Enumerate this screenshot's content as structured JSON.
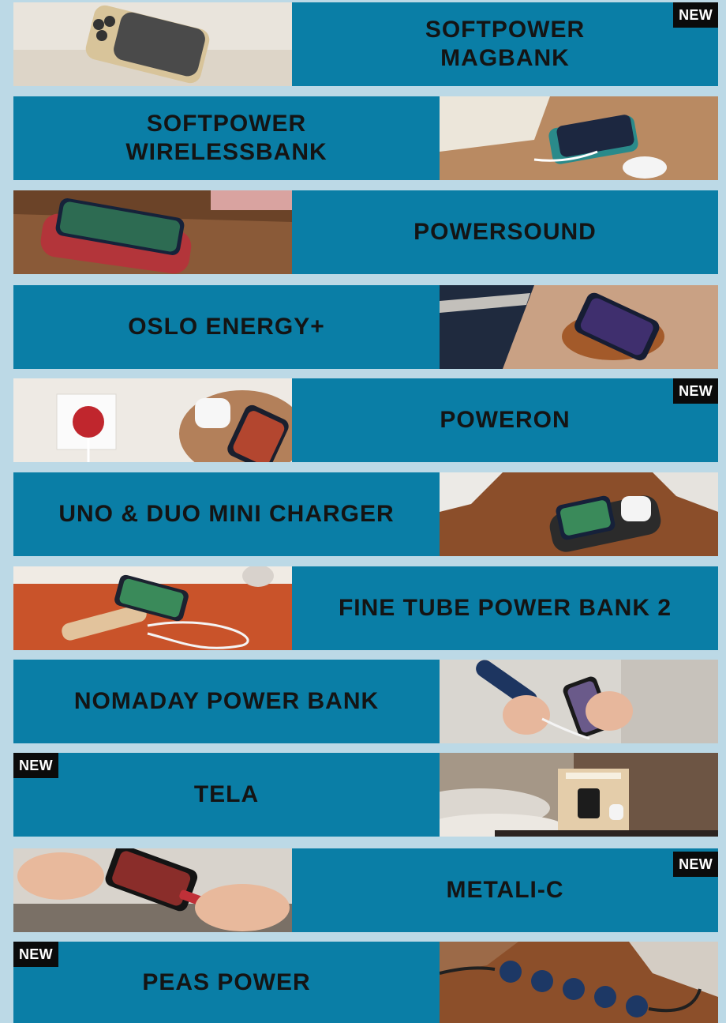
{
  "badge_text": "NEW",
  "colors": {
    "background": "#bcd9e6",
    "card": "#0a7ea6",
    "text": "#141414",
    "badge": "#0b0b0b"
  },
  "products": [
    {
      "name": "SOFTPOWER\nMAGBANK",
      "badge": "NEW",
      "photo": "power-bank-on-phone-photo"
    },
    {
      "name": "SOFTPOWER\nWIRELESSBANK",
      "badge": "",
      "photo": "wireless-bank-on-desk-photo"
    },
    {
      "name": "POWERSOUND",
      "badge": "",
      "photo": "phone-on-red-speaker-photo"
    },
    {
      "name": "OSLO ENERGY+",
      "badge": "",
      "photo": "phone-on-leather-charger-photo"
    },
    {
      "name": "POWERON",
      "badge": "NEW",
      "photo": "wall-charger-and-earbuds-photo"
    },
    {
      "name": "UNO & DUO MINI CHARGER",
      "badge": "",
      "photo": "duo-charger-on-wood-photo"
    },
    {
      "name": "FINE TUBE POWER BANK 2",
      "badge": "",
      "photo": "tube-power-bank-orange-table-photo"
    },
    {
      "name": "NOMADAY POWER BANK",
      "badge": "",
      "photo": "hands-holding-power-bank-photo"
    },
    {
      "name": "TELA",
      "badge": "NEW",
      "photo": "bedside-charging-lamp-photo"
    },
    {
      "name": "METALI-C",
      "badge": "NEW",
      "photo": "hand-plugging-cable-photo"
    },
    {
      "name": "PEAS POWER",
      "badge": "NEW",
      "photo": "blue-power-strip-photo"
    }
  ]
}
